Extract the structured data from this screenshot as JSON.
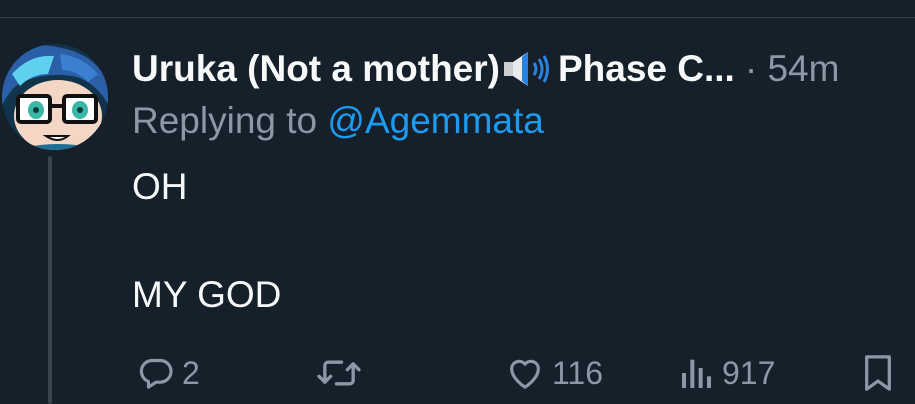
{
  "tweet": {
    "author": {
      "display_name": "Uruka (Not a mother)",
      "display_name_suffix": "Phase C...",
      "badge_icon": "speaker-icon"
    },
    "meta": "· 54m",
    "replying_to": {
      "prefix": "Replying to ",
      "handle": "@Agemmata"
    },
    "text_lines": [
      "OH",
      "MY GOD"
    ],
    "actions": {
      "reply": {
        "icon": "reply-icon",
        "count": "2"
      },
      "retweet": {
        "icon": "retweet-icon",
        "count": ""
      },
      "like": {
        "icon": "heart-icon",
        "count": "116"
      },
      "views": {
        "icon": "views-icon",
        "count": "917"
      },
      "bookmark": {
        "icon": "bookmark-icon"
      }
    }
  },
  "colors": {
    "background": "#15202b",
    "text_primary": "#f7f9f9",
    "text_secondary": "#8b98a5",
    "link": "#1d9bf0",
    "divider": "#38444d"
  }
}
